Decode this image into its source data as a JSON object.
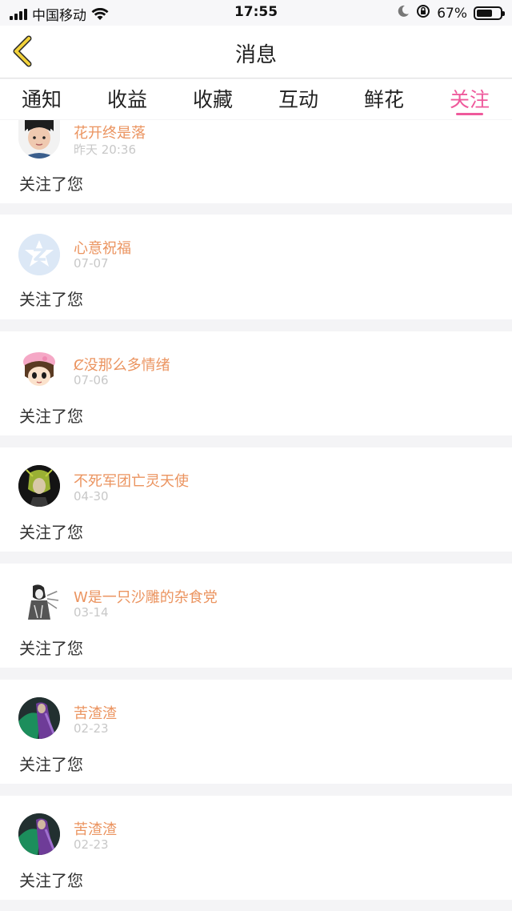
{
  "status": {
    "carrier": "中国移动",
    "time": "17:55",
    "battery_pct": "67%",
    "battery_level": 0.67
  },
  "nav": {
    "title": "消息",
    "back_icon": "chevron-left-icon",
    "accent": "#f2d23a"
  },
  "tabs": [
    {
      "label": "通知",
      "active": false
    },
    {
      "label": "收益",
      "active": false
    },
    {
      "label": "收藏",
      "active": false
    },
    {
      "label": "互动",
      "active": false
    },
    {
      "label": "鲜花",
      "active": false
    },
    {
      "label": "关注",
      "active": true
    }
  ],
  "colors": {
    "tab_active": "#ef5a9c",
    "username": "#eb9460",
    "date": "#c8c8c8"
  },
  "items": [
    {
      "name": "花开终是落",
      "date": "昨天 20:36",
      "action": "关注了您",
      "avatar": "photo-avatar"
    },
    {
      "name": "心意祝福",
      "date": "07-07",
      "action": "关注了您",
      "avatar": "default-avatar"
    },
    {
      "name": "Ȼ没那么多情绪",
      "date": "07-06",
      "action": "关注了您",
      "avatar": "cartoon-pig-hat-avatar"
    },
    {
      "name": "不死军团亡灵天使",
      "date": "04-30",
      "action": "关注了您",
      "avatar": "anime-avatar"
    },
    {
      "name": "W是一只沙雕的杂食党",
      "date": "03-14",
      "action": "关注了您",
      "avatar": "sketch-avatar"
    },
    {
      "name": "苦渣渣",
      "date": "02-23",
      "action": "关注了您",
      "avatar": "purple-character-avatar"
    },
    {
      "name": "苦渣渣",
      "date": "02-23",
      "action": "关注了您",
      "avatar": "purple-character-avatar"
    }
  ]
}
